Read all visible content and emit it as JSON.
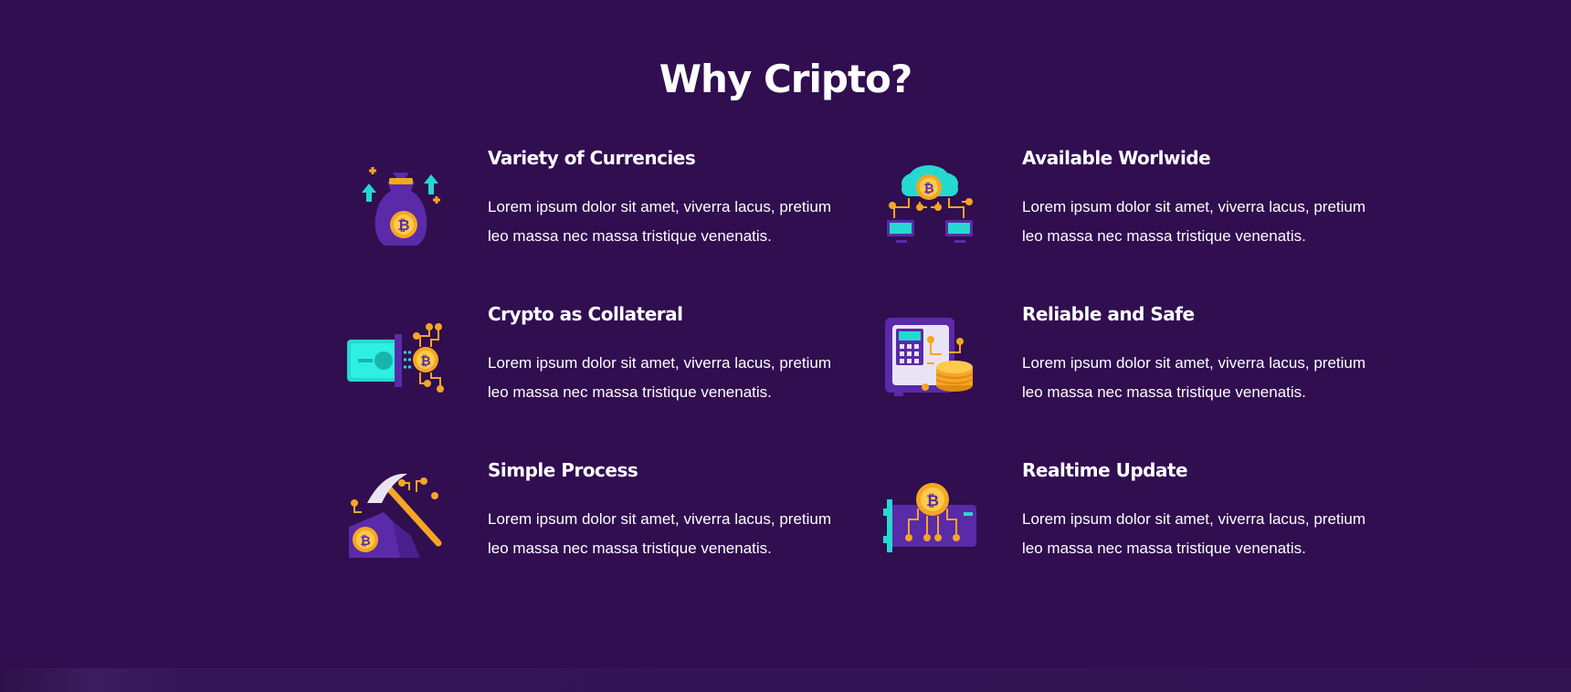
{
  "section": {
    "title": "Why Cripto?"
  },
  "features": [
    {
      "title": "Variety of Currencies",
      "desc": "Lorem ipsum dolor sit amet, viverra lacus, pretium leo massa nec massa tristique venenatis.",
      "icon": "bitcoin-money-bag-icon"
    },
    {
      "title": "Available Worlwide",
      "desc": "Lorem ipsum dolor sit amet, viverra lacus, pretium leo massa nec massa tristique venenatis.",
      "icon": "cloud-network-icon"
    },
    {
      "title": "Crypto as Collateral",
      "desc": "Lorem ipsum dolor sit amet, viverra lacus, pretium leo massa nec massa tristique venenatis.",
      "icon": "banknote-to-bitcoin-icon"
    },
    {
      "title": "Reliable and Safe",
      "desc": "Lorem ipsum dolor sit amet, viverra lacus, pretium leo massa nec massa tristique venenatis.",
      "icon": "safe-with-coins-icon"
    },
    {
      "title": "Simple Process",
      "desc": "Lorem ipsum dolor sit amet, viverra lacus, pretium leo massa nec massa tristique venenatis.",
      "icon": "mining-pickaxe-icon"
    },
    {
      "title": "Realtime Update",
      "desc": "Lorem ipsum dolor sit amet, viverra lacus, pretium leo massa nec massa tristique venenatis.",
      "icon": "bitcoin-circuit-card-icon"
    }
  ],
  "colors": {
    "background": "#300e50",
    "accent_purple": "#5a2aa8",
    "accent_teal": "#25d9d0",
    "accent_orange": "#f5a623"
  }
}
